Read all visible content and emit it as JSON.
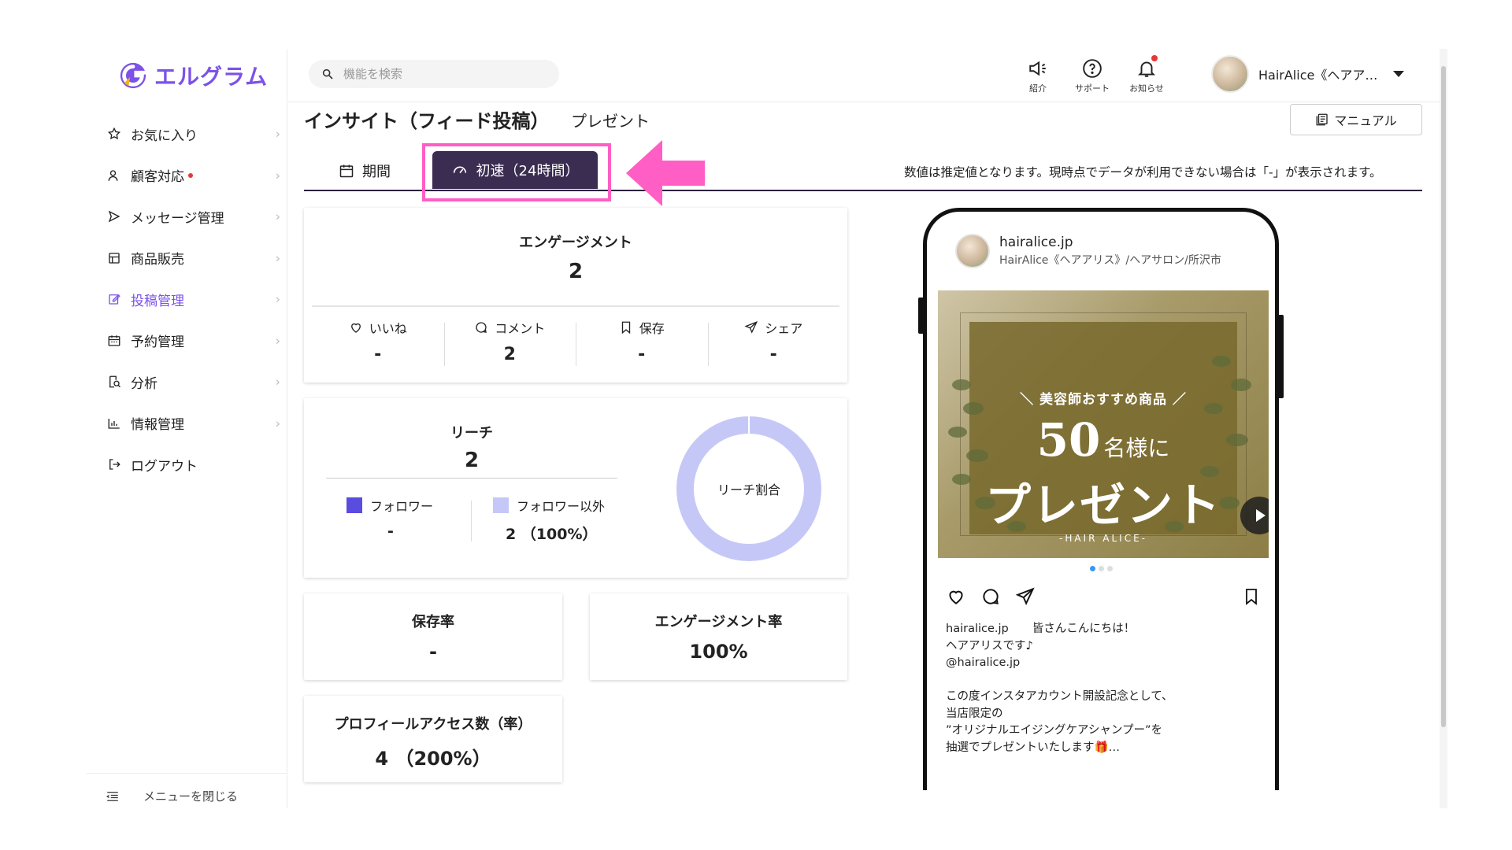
{
  "brand": {
    "name": "エルグラム",
    "color": "#7c52e8"
  },
  "sidebar": {
    "items": [
      {
        "label": "お気に入り",
        "icon": "star-icon"
      },
      {
        "label": "顧客対応",
        "icon": "user-icon",
        "badge": true
      },
      {
        "label": "メッセージ管理",
        "icon": "send-icon"
      },
      {
        "label": "商品販売",
        "icon": "store-icon"
      },
      {
        "label": "投稿管理",
        "icon": "edit-icon",
        "active": true
      },
      {
        "label": "予約管理",
        "icon": "calendar-icon"
      },
      {
        "label": "分析",
        "icon": "search-doc-icon"
      },
      {
        "label": "情報管理",
        "icon": "bar-chart-icon"
      },
      {
        "label": "ログアウト",
        "icon": "logout-icon"
      }
    ],
    "collapse_label": "メニューを閉じる"
  },
  "header": {
    "search_placeholder": "機能を検索",
    "icons": [
      {
        "label": "紹介",
        "icon": "megaphone-icon"
      },
      {
        "label": "サポート",
        "icon": "help-icon"
      },
      {
        "label": "お知らせ",
        "icon": "bell-icon"
      }
    ],
    "user_name": "HairAlice《ヘアア…"
  },
  "page": {
    "title": "インサイト（フィード投稿）",
    "subtitle": "プレゼント",
    "manual_label": "マニュアル",
    "tabs": [
      {
        "label": "期間",
        "icon": "calendar-icon"
      },
      {
        "label": "初速（24時間）",
        "icon": "speedometer-icon",
        "active": true
      }
    ],
    "notice": "数値は推定値となります。現時点でデータが利用できない場合は「-」が表示されます。"
  },
  "engagement": {
    "title": "エンゲージメント",
    "value": "2",
    "metrics": [
      {
        "label": "いいね",
        "value": "-",
        "icon": "heart-icon"
      },
      {
        "label": "コメント",
        "value": "2",
        "icon": "comment-icon"
      },
      {
        "label": "保存",
        "value": "-",
        "icon": "bookmark-icon"
      },
      {
        "label": "シェア",
        "value": "-",
        "icon": "share-icon"
      }
    ]
  },
  "reach": {
    "title": "リーチ",
    "value": "2",
    "followers_label": "フォロワー",
    "followers_value": "-",
    "non_followers_label": "フォロワー以外",
    "non_followers_value": "2 （100%）",
    "donut_label": "リーチ割合",
    "colors": {
      "followers": "#5b4ce0",
      "non_followers": "#c5c8f7"
    }
  },
  "chart_data": {
    "type": "pie",
    "categories": [
      "フォロワー",
      "フォロワー以外"
    ],
    "values": [
      0,
      100
    ],
    "title": "リーチ割合"
  },
  "save_rate": {
    "title": "保存率",
    "value": "-"
  },
  "engagement_rate": {
    "title": "エンゲージメント率",
    "value": "100%"
  },
  "profile_access": {
    "title": "プロフィールアクセス数（率）",
    "value": "4 （200%）"
  },
  "post": {
    "account": "hairalice.jp",
    "account_sub": "HairAlice《ヘアアリス》/ヘアサロン/所沢市",
    "image_text_1": "＼ 美容師おすすめ商品 ／",
    "image_text_2_big": "50",
    "image_text_2_small": "名様に",
    "image_text_3": "プレゼント",
    "image_text_4": "-HAIR ALICE-",
    "caption_account": "hairalice.jp",
    "caption_lines": [
      "皆さんこんにちは！",
      "ヘアアリスです♪",
      "@hairalice.jp",
      "",
      "この度インスタアカウント開設記念として、",
      "当店限定の",
      "”オリジナルエイジングケアシャンプー”を",
      "抽選でプレゼントいたします🎁…"
    ]
  },
  "annotation_color": "#ff5ec4"
}
